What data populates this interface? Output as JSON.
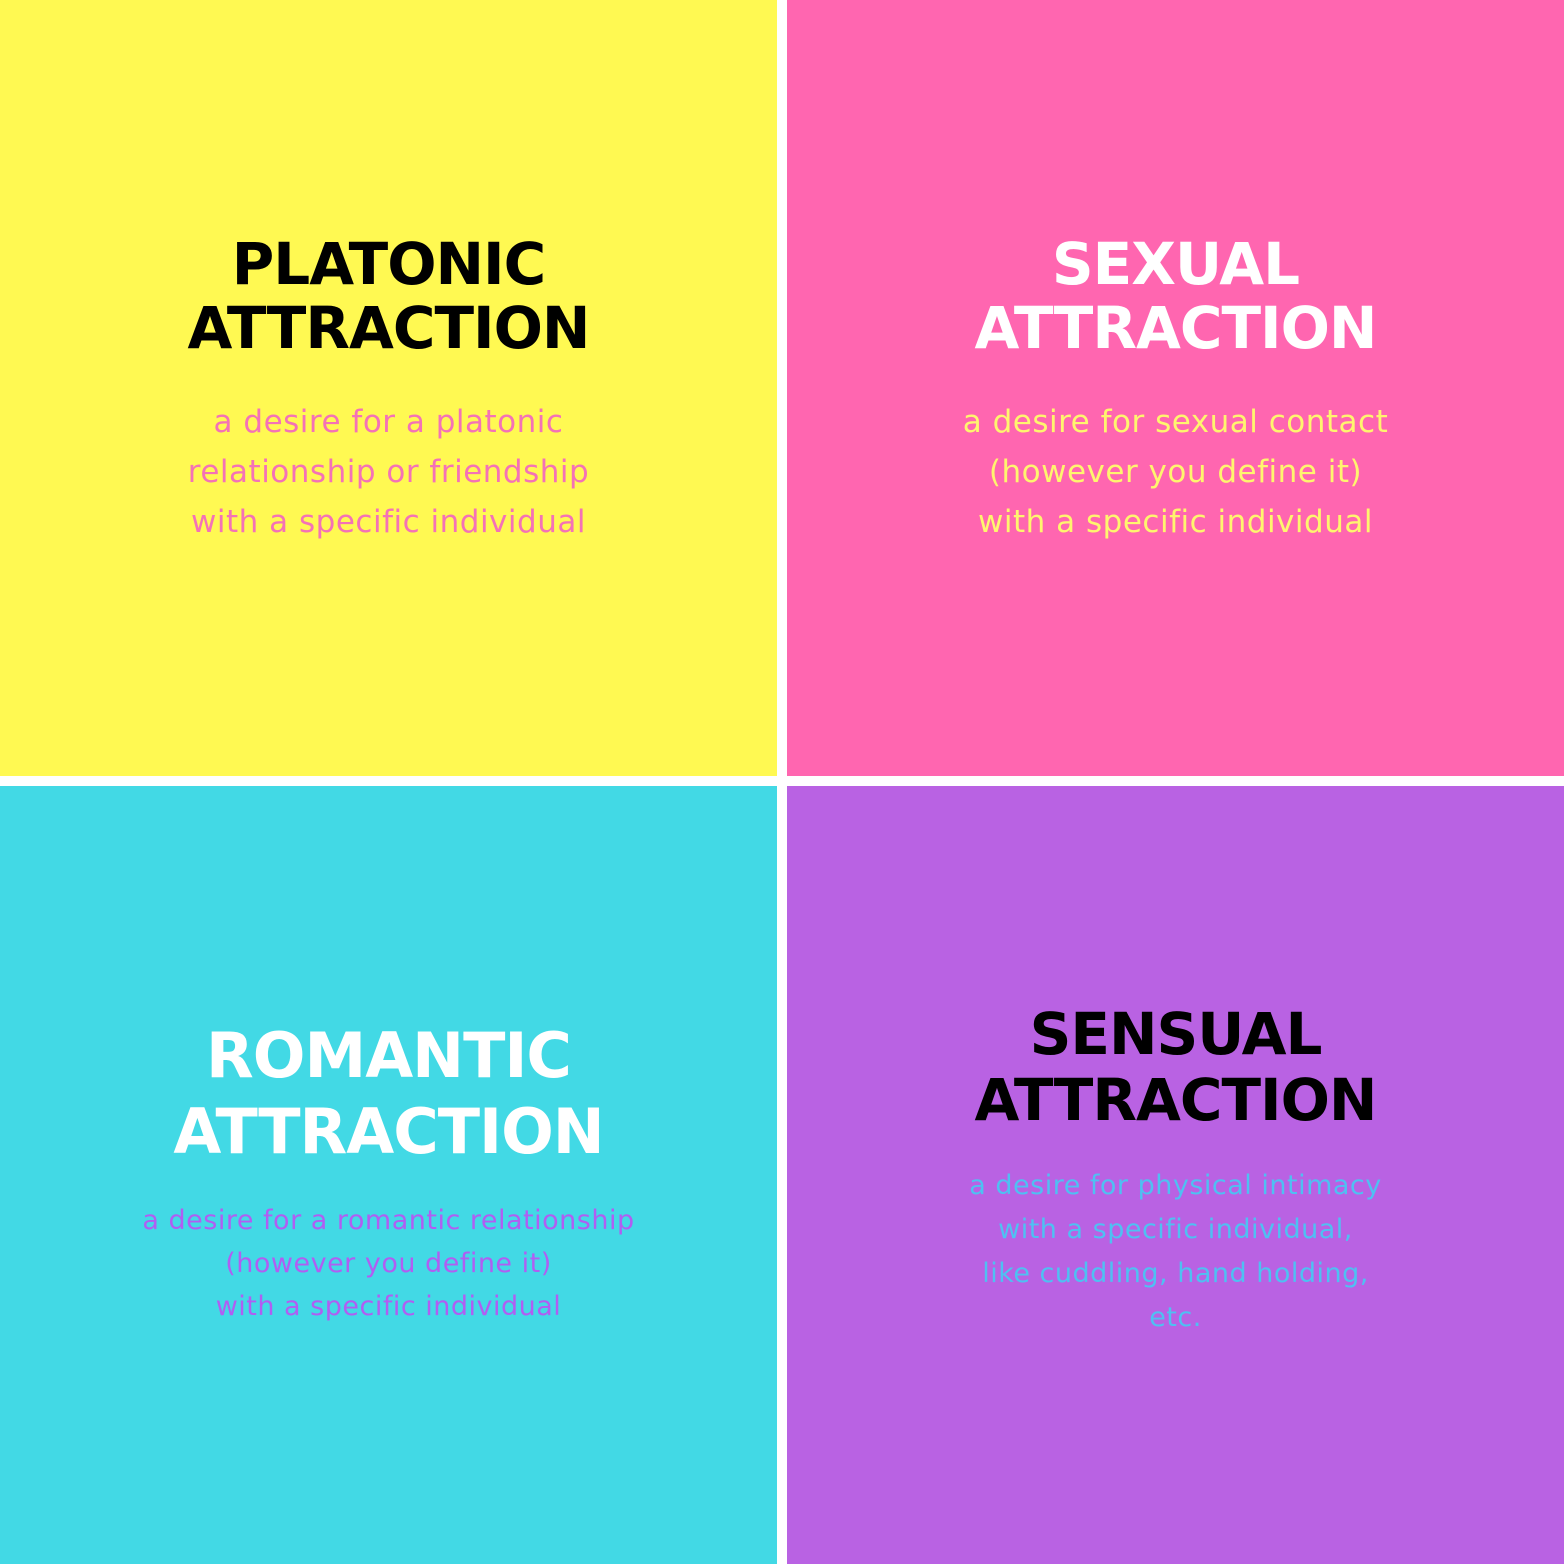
{
  "colors": {
    "divider": "#ffffff"
  },
  "panels": [
    {
      "id": "platonic",
      "background": "#fff952",
      "title_color": "#000000",
      "desc_color": "#f472b6",
      "title_lines": [
        "PLATONIC",
        "ATTRACTION"
      ],
      "desc_lines": [
        "a desire for a platonic",
        "relationship or friendship",
        "with a specific individual"
      ]
    },
    {
      "id": "sexual",
      "background": "#ff66b0",
      "title_color": "#ffffff",
      "desc_color": "#fff56e",
      "title_lines": [
        "SEXUAL",
        "ATTRACTION"
      ],
      "desc_lines": [
        "a desire for sexual contact",
        "(however you define it)",
        "with a specific individual"
      ]
    },
    {
      "id": "romantic",
      "background": "#42d9e5",
      "title_color": "#ffffff",
      "desc_color": "#b05ef2",
      "title_lines": [
        "ROMANTIC",
        "ATTRACTION"
      ],
      "desc_lines": [
        "a desire for a romantic relationship",
        "(however you define it)",
        "with a specific individual"
      ]
    },
    {
      "id": "sensual",
      "background": "#b962e3",
      "title_color": "#000000",
      "desc_color": "#4fc0f2",
      "title_lines": [
        "SENSUAL",
        "ATTRACTION"
      ],
      "desc_lines": [
        "a desire for physical intimacy",
        "with a specific individual,",
        "like cuddling, hand holding,",
        "etc."
      ]
    }
  ]
}
